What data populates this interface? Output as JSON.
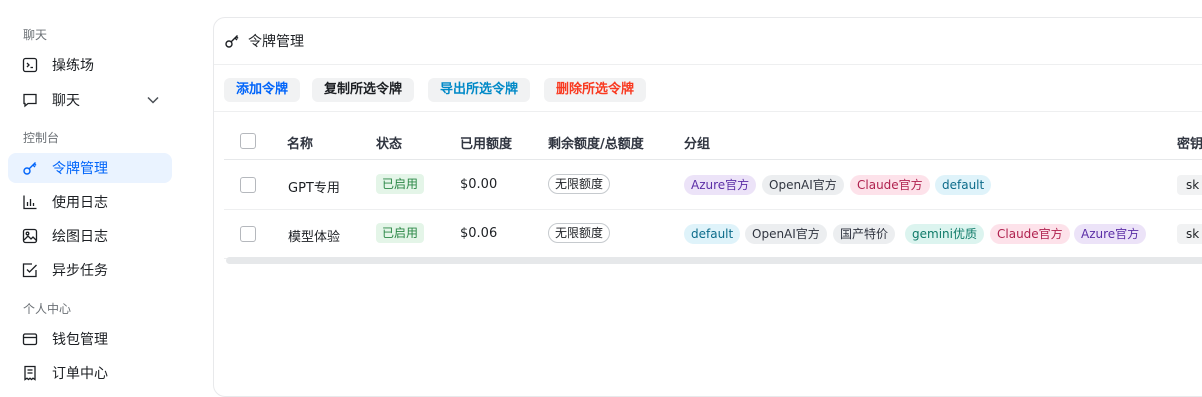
{
  "sidebar": {
    "sections": [
      {
        "label": "聊天",
        "items": [
          {
            "label": "操练场",
            "icon": "terminal-icon"
          },
          {
            "label": "聊天",
            "icon": "chat-bubble-icon"
          }
        ]
      },
      {
        "label": "控制台",
        "items": [
          {
            "label": "令牌管理",
            "icon": "key-icon",
            "active": true
          },
          {
            "label": "使用日志",
            "icon": "bar-chart-icon"
          },
          {
            "label": "绘图日志",
            "icon": "image-icon"
          },
          {
            "label": "异步任务",
            "icon": "checkbox-icon"
          }
        ]
      },
      {
        "label": "个人中心",
        "items": [
          {
            "label": "钱包管理",
            "icon": "wallet-icon"
          },
          {
            "label": "订单中心",
            "icon": "receipt-icon"
          }
        ]
      }
    ]
  },
  "header": {
    "title": "令牌管理",
    "icon": "key-icon"
  },
  "toolbar": {
    "add": "添加令牌",
    "copy": "复制所选令牌",
    "export": "导出所选令牌",
    "delete": "删除所选令牌"
  },
  "table": {
    "headers": [
      "名称",
      "状态",
      "已用额度",
      "剩余额度/总额度",
      "分组",
      "密钥"
    ],
    "rows": [
      {
        "name": "GPT专用",
        "status": "已启用",
        "used": "$0.00",
        "quota": "无限额度",
        "groups": [
          "Azure官方",
          "OpenAI官方",
          "Claude官方",
          "default"
        ],
        "key": "sk"
      },
      {
        "name": "模型体验",
        "status": "已启用",
        "used": "$0.06",
        "quota": "无限额度",
        "groups": [
          "default",
          "OpenAI官方",
          "国产特价",
          "gemini优质",
          "Claude官方",
          "Azure官方"
        ],
        "key": "sk"
      }
    ]
  },
  "colors": {
    "accent": "#0064fa",
    "active_bg": "#eaf3ff",
    "status_bg": "#e4f5e8",
    "status_text": "#2a8745",
    "danger": "#f93920"
  }
}
